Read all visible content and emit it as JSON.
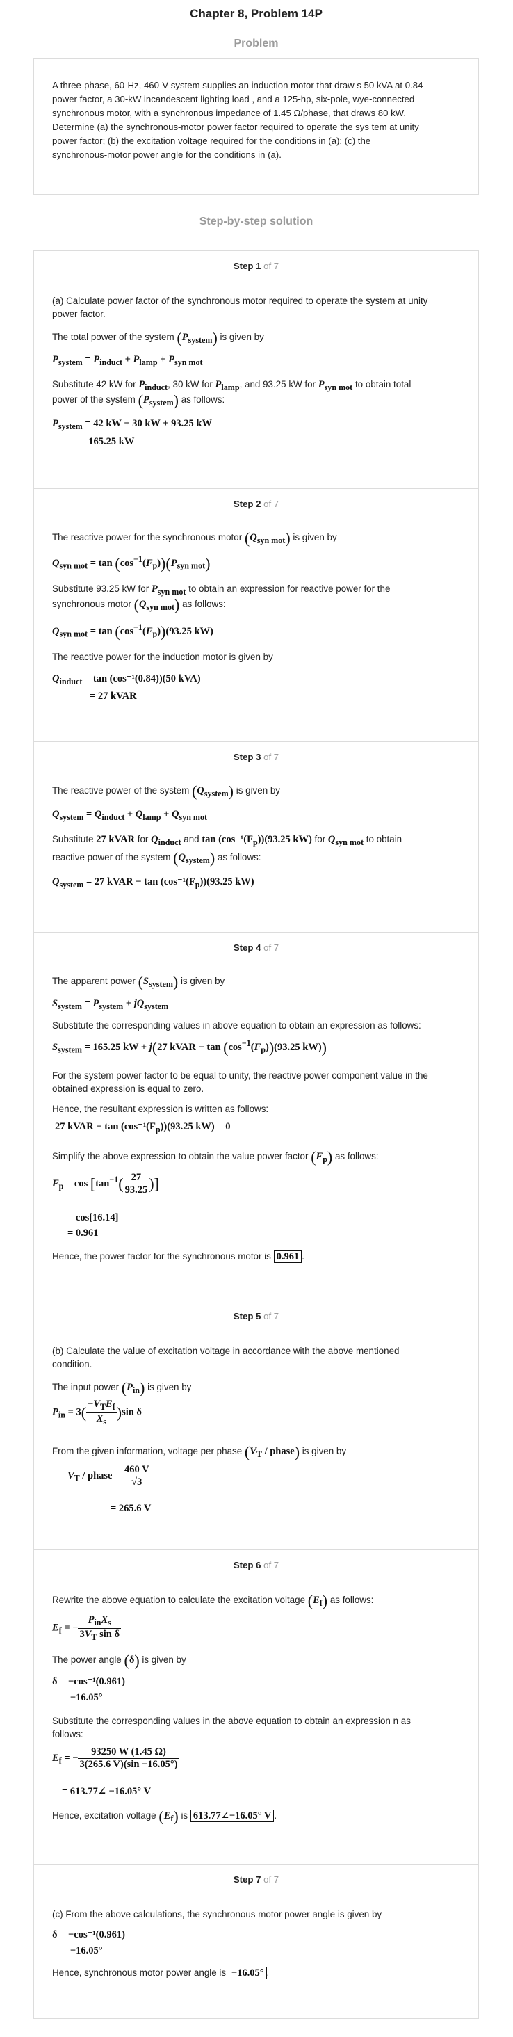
{
  "header": {
    "title": "Chapter 8, Problem 14P",
    "problem_label": "Problem",
    "solution_label": "Step-by-step solution"
  },
  "problem": {
    "lines": [
      "A three-phase, 60-Hz, 460-V system supplies an induction motor that draw s 50 kVA at 0.84",
      "power factor, a 30-kW incandescent lighting load , and a 125-hp, six-pole, wye-connected",
      "synchronous motor, with a synchronous impedance of 1.45 Ω/phase, that draws 80 kW.",
      "Determine (a) the synchronous-motor power factor required to operate the sys tem at unity",
      "power factor; (b) the excitation voltage required for the conditions in (a); (c) the",
      "synchronous-motor power angle for the conditions in (a)."
    ]
  },
  "step_of": "of 7",
  "steps": [
    {
      "label": "Step 1",
      "t1": "(a) Calculate power factor of the synchronous motor required to operate the system at unity",
      "t2": "power factor.",
      "t3": "The total power of the system",
      "t3b": "is given by",
      "t4": "Substitute 42 kW for",
      "t4b": ", 30 kW for",
      "t4c": ", and 93.25 kW for",
      "t4d": "to obtain total",
      "t5": "power of the system",
      "t5b": "as follows:",
      "m1": "= 42 kW + 30 kW + 93.25 kW",
      "m2": "=165.25 kW"
    },
    {
      "label": "Step 2",
      "t1": "The reactive power for the synchronous motor",
      "t1b": "is given by",
      "t2": "Substitute 93.25 kW for",
      "t2b": "to obtain an expression for reactive power for the",
      "t3": "synchronous motor",
      "t3b": "as follows:",
      "t4": "The reactive power for the induction motor is given by",
      "m1": "= tan (cos⁻¹(0.84))(50 kVA)",
      "m2": "= 27 kVAR"
    },
    {
      "label": "Step 3",
      "t1": "The reactive power of the system",
      "t1b": "is given by",
      "t2": "Substitute",
      "t2a": "27 kVAR",
      "t2b": "for",
      "t2c": "and",
      "t2d": "tan (cos⁻¹(F",
      "t2e": "))(93.25 kW)",
      "t2f": "for",
      "t2g": "to obtain",
      "t3": "reactive power of the system",
      "t3b": "as follows:",
      "m1": "= 27 kVAR − tan (cos⁻¹(F",
      "m1b": "))(93.25 kW)"
    },
    {
      "label": "Step 4",
      "t1": "The apparent power",
      "t1b": "is given by",
      "t2": "Substitute the corresponding values in above equation to obtain an expression as follows:",
      "t3": "For the system power factor to be equal to unity, the reactive power component value in the",
      "t4": "obtained expression is equal to zero.",
      "t5": "Hence, the resultant expression is written as follows:",
      "t6": "Simplify the above expression to obtain the value power factor",
      "t6b": "as follows:",
      "t7": "Hence, the power factor for the synchronous motor is",
      "ans": "0.961",
      "m_eq": "27 kVAR − tan (cos⁻¹(F",
      "m_eq2": "))(93.25 kW) = 0",
      "frac_n": "27",
      "frac_d": "93.25",
      "m_cos": "= cos[16.14]",
      "m_val": "= 0.961"
    },
    {
      "label": "Step 5",
      "t1": "(b) Calculate the value of excitation voltage in accordance with the above mentioned",
      "t2": "condition.",
      "t3": "The input power",
      "t3b": "is given by",
      "t4": "From the given information, voltage per phase",
      "t4b": "is given by",
      "frac_n": "460 V",
      "frac_d": "√3",
      "m_val": "= 265.6 V"
    },
    {
      "label": "Step 6",
      "t1": "Rewrite the above equation to calculate the excitation voltage",
      "t1b": "as follows:",
      "t2": "The power angle",
      "t2b": "is given by",
      "t3": "Substitute the corresponding values in the above equation to obtain an expression n as",
      "t4": "follows:",
      "t5": "Hence, excitation voltage",
      "t5b": "is",
      "ans": "613.77∠−16.05° V",
      "m_d1": "δ = −cos⁻¹(0.961)",
      "m_d2": "= −16.05°",
      "frac_n": "93250 W (1.45 Ω)",
      "frac_d": "3(265.6 V)(sin −16.05°)",
      "m_val": "= 613.77∠ −16.05° V"
    },
    {
      "label": "Step 7",
      "t1": "(c) From the above calculations, the synchronous motor power angle is given by",
      "t2": "Hence, synchronous motor power angle is",
      "ans": "−16.05°",
      "m_d1": "δ = −cos⁻¹(0.961)",
      "m_d2": "= −16.05°"
    }
  ]
}
